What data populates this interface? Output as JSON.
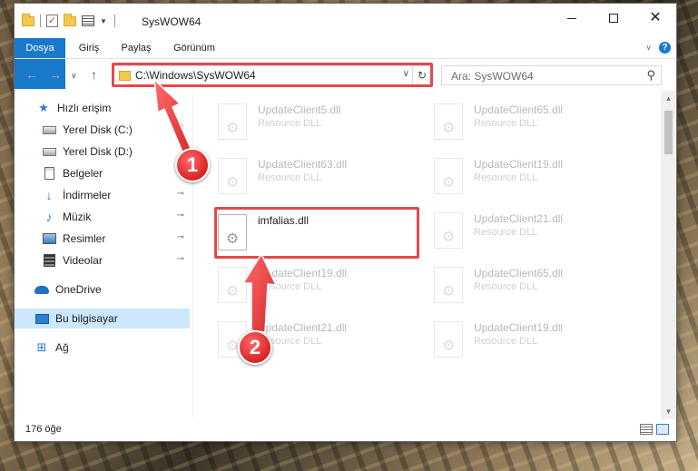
{
  "window": {
    "title": "SysWOW64"
  },
  "ribbon": {
    "tabs": [
      {
        "label": "Dosya"
      },
      {
        "label": "Giriş"
      },
      {
        "label": "Paylaş"
      },
      {
        "label": "Görünüm"
      }
    ]
  },
  "address": {
    "path": "C:\\Windows\\SysWOW64",
    "search_placeholder": "Ara: SysWOW64"
  },
  "sidebar": {
    "items": [
      {
        "label": "Hızlı erişim",
        "icon": "star-icon",
        "pinned": false
      },
      {
        "label": "Yerel Disk (C:)",
        "icon": "disk-icon",
        "pinned": true
      },
      {
        "label": "Yerel Disk (D:)",
        "icon": "disk-icon",
        "pinned": false
      },
      {
        "label": "Belgeler",
        "icon": "document-icon",
        "pinned": true
      },
      {
        "label": "İndirmeler",
        "icon": "download-icon",
        "pinned": true
      },
      {
        "label": "Müzik",
        "icon": "music-icon",
        "pinned": true
      },
      {
        "label": "Resimler",
        "icon": "pictures-icon",
        "pinned": true
      },
      {
        "label": "Videolar",
        "icon": "video-icon",
        "pinned": true
      },
      {
        "label": "OneDrive",
        "icon": "cloud-icon",
        "pinned": false
      },
      {
        "label": "Bu bilgisayar",
        "icon": "computer-icon",
        "selected": true
      },
      {
        "label": "Ağ",
        "icon": "network-icon",
        "pinned": false
      }
    ]
  },
  "files": {
    "left": [
      {
        "name": "UpdateClient5.dll",
        "type": "Resource DLL"
      },
      {
        "name": "UpdateClient63.dll",
        "type": "Resource DLL"
      },
      {
        "name": "imfalias.dll",
        "type": ""
      },
      {
        "name": "UpdateClient19.dll",
        "type": "Resource DLL"
      },
      {
        "name": "UpdateClient21.dll",
        "type": "Resource DLL"
      }
    ],
    "right": [
      {
        "name": "UpdateClient65.dll",
        "type": "Resource DLL"
      },
      {
        "name": "UpdateClient19.dll",
        "type": "Resource DLL"
      },
      {
        "name": "UpdateClient21.dll",
        "type": "Resource DLL"
      },
      {
        "name": "UpdateClient65.dll",
        "type": "Resource DLL"
      },
      {
        "name": "UpdateClient19.dll",
        "type": "Resource DLL"
      }
    ]
  },
  "annotations": {
    "badge1": "1",
    "badge2": "2",
    "highlight_color": "#e34a4a"
  },
  "status": {
    "count": "176 öğe"
  }
}
